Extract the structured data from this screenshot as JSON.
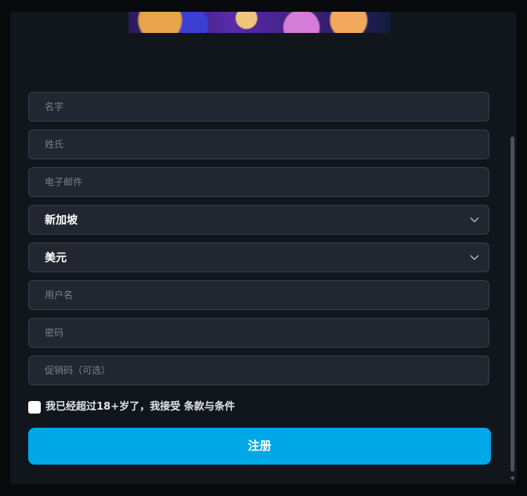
{
  "banner": {
    "icon": "casino-promo-image"
  },
  "form": {
    "first_name": {
      "placeholder": "名字"
    },
    "last_name": {
      "placeholder": "姓氏"
    },
    "email": {
      "placeholder": "电子邮件"
    },
    "country": {
      "value": "新加坡"
    },
    "currency": {
      "value": "美元"
    },
    "username": {
      "placeholder": "用户名"
    },
    "password": {
      "placeholder": "密码"
    },
    "promo": {
      "placeholder": "促销码（可选）"
    },
    "terms": {
      "label": "我已经超过18+岁了，我接受 条款与条件",
      "checked": false
    },
    "submit_label": "注册"
  },
  "colors": {
    "accent": "#00a8e8",
    "background": "#11151c",
    "field": "#222631"
  }
}
